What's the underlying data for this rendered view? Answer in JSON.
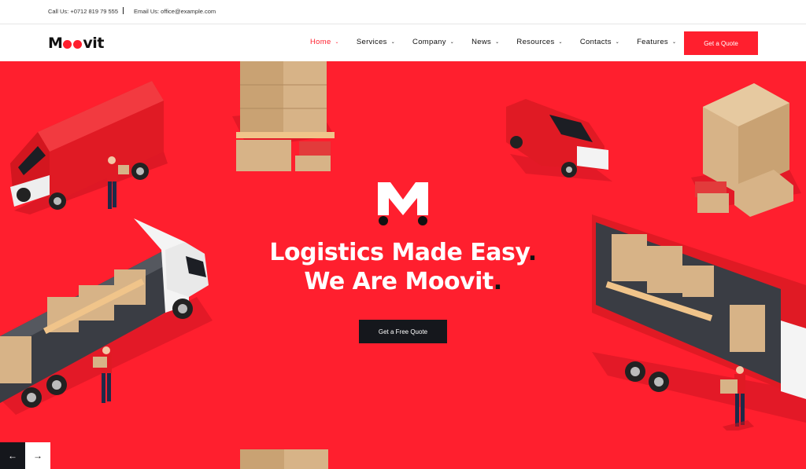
{
  "topbar": {
    "call": "Call Us: +0712 819 79 555",
    "email": "Email Us: office@example.com"
  },
  "header": {
    "logo": {
      "pre": "M",
      "post": "vit"
    },
    "nav": [
      {
        "label": "Home",
        "active": true
      },
      {
        "label": "Services"
      },
      {
        "label": "Company"
      },
      {
        "label": "News"
      },
      {
        "label": "Resources"
      },
      {
        "label": "Contacts"
      },
      {
        "label": "Features"
      }
    ],
    "quote_button": "Get a Quote"
  },
  "hero": {
    "line1": "Logistics Made Easy",
    "line2": "We Are Moovit",
    "period": ".",
    "cta": "Get a Free Quote",
    "prev": "←",
    "next": "→",
    "background_color": "#ff1f2e"
  },
  "colors": {
    "accent": "#ff1f2e",
    "dark": "#15171c"
  }
}
